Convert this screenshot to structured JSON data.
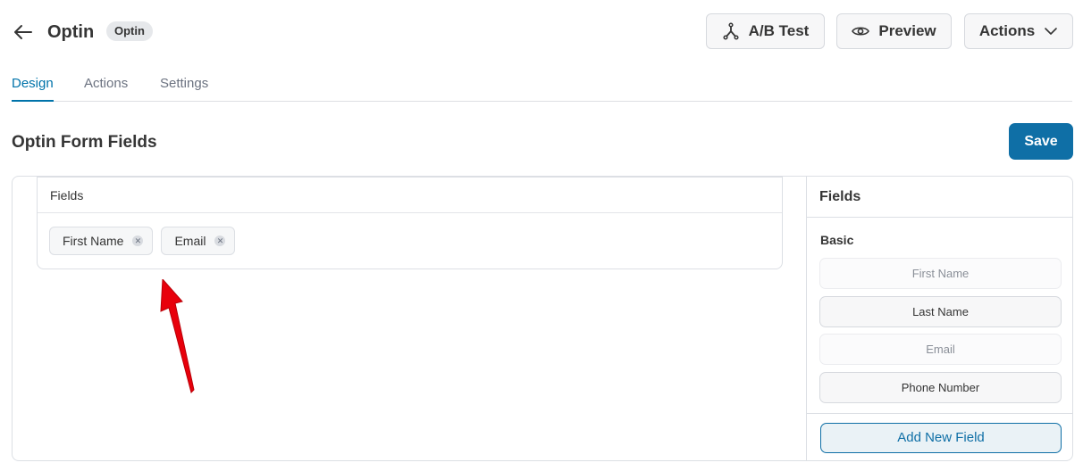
{
  "header": {
    "title": "Optin",
    "badge": "Optin",
    "back_icon": "arrow-left-icon"
  },
  "toolbar": {
    "ab_test_label": "A/B Test",
    "ab_test_icon": "split-branch-icon",
    "preview_label": "Preview",
    "preview_icon": "eye-icon",
    "actions_label": "Actions",
    "actions_icon": "chevron-down-icon"
  },
  "tabs": [
    {
      "label": "Design",
      "active": true
    },
    {
      "label": "Actions",
      "active": false
    },
    {
      "label": "Settings",
      "active": false
    }
  ],
  "section": {
    "title": "Optin Form Fields",
    "save_label": "Save"
  },
  "form_fields": {
    "heading": "Fields",
    "chips": [
      {
        "label": "First Name",
        "remove_icon": "close-icon"
      },
      {
        "label": "Email",
        "remove_icon": "close-icon"
      }
    ]
  },
  "sidebar": {
    "heading": "Fields",
    "group_label": "Basic",
    "options": [
      {
        "label": "First Name",
        "enabled": false
      },
      {
        "label": "Last Name",
        "enabled": true
      },
      {
        "label": "Email",
        "enabled": false
      },
      {
        "label": "Phone Number",
        "enabled": true
      }
    ],
    "add_button_label": "Add New Field"
  },
  "colors": {
    "accent": "#0f6fa6",
    "annotation_arrow": "#e8000b"
  }
}
